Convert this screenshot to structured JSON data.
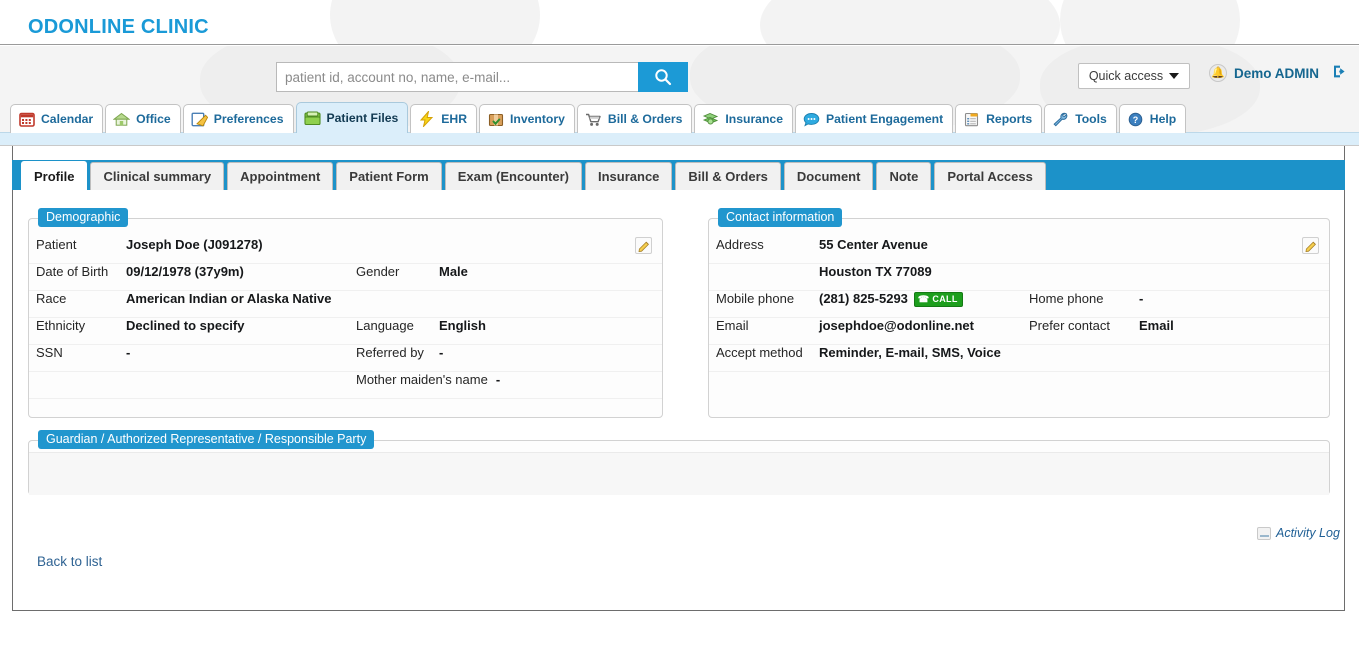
{
  "header": {
    "brand": "ODONLINE CLINIC",
    "search": {
      "placeholder": "patient id, account no, name, e-mail...",
      "value": "",
      "button_icon": "search-icon"
    },
    "quick_access_label": "Quick access",
    "user_name": "Demo ADMIN",
    "bell_icon": "bell-icon",
    "logout_icon": "logout-icon"
  },
  "main_nav": [
    {
      "label": "Calendar",
      "icon": "calendar-icon",
      "active": false
    },
    {
      "label": "Office",
      "icon": "home-icon",
      "active": false
    },
    {
      "label": "Preferences",
      "icon": "note-pencil-icon",
      "active": false
    },
    {
      "label": "Patient Files",
      "icon": "folder-icon",
      "active": true
    },
    {
      "label": "EHR",
      "icon": "lightning-icon",
      "active": false
    },
    {
      "label": "Inventory",
      "icon": "box-icon",
      "active": false
    },
    {
      "label": "Bill & Orders",
      "icon": "cart-icon",
      "active": false
    },
    {
      "label": "Insurance",
      "icon": "money-icon",
      "active": false
    },
    {
      "label": "Patient Engagement",
      "icon": "chat-icon",
      "active": false
    },
    {
      "label": "Reports",
      "icon": "clipboard-icon",
      "active": false
    },
    {
      "label": "Tools",
      "icon": "wrench-icon",
      "active": false
    },
    {
      "label": "Help",
      "icon": "help-icon",
      "active": false
    }
  ],
  "sub_tabs": [
    {
      "label": "Profile",
      "active": true
    },
    {
      "label": "Clinical summary",
      "active": false
    },
    {
      "label": "Appointment",
      "active": false
    },
    {
      "label": "Patient Form",
      "active": false
    },
    {
      "label": "Exam (Encounter)",
      "active": false
    },
    {
      "label": "Insurance",
      "active": false
    },
    {
      "label": "Bill & Orders",
      "active": false
    },
    {
      "label": "Document",
      "active": false
    },
    {
      "label": "Note",
      "active": false
    },
    {
      "label": "Portal Access",
      "active": false
    }
  ],
  "demographic": {
    "legend": "Demographic",
    "edit_icon": "edit-pencil-icon",
    "patient_label": "Patient",
    "patient_value": "Joseph Doe (J091278)",
    "dob_label": "Date of Birth",
    "dob_value": "09/12/1978 (37y9m)",
    "gender_label": "Gender",
    "gender_value": "Male",
    "race_label": "Race",
    "race_value": "American Indian or Alaska Native",
    "ethnicity_label": "Ethnicity",
    "ethnicity_value": "Declined to specify",
    "language_label": "Language",
    "language_value": "English",
    "ssn_label": "SSN",
    "ssn_value": "-",
    "referred_by_label": "Referred by",
    "referred_by_value": "-",
    "mother_maiden_label": "Mother maiden's name",
    "mother_maiden_value": "-"
  },
  "contact": {
    "legend": "Contact information",
    "edit_icon": "edit-pencil-icon",
    "address_label": "Address",
    "address_line1": "55 Center Avenue",
    "address_line2": "Houston TX 77089",
    "mobile_label": "Mobile phone",
    "mobile_value": "(281) 825-5293",
    "call_button_label": "CALL",
    "home_phone_label": "Home phone",
    "home_phone_value": "-",
    "email_label": "Email",
    "email_value": "josephdoe@odonline.net",
    "prefer_contact_label": "Prefer contact",
    "prefer_contact_value": "Email",
    "accept_method_label": "Accept method",
    "accept_method_value": "Reminder, E-mail, SMS, Voice"
  },
  "guardian": {
    "legend": "Guardian / Authorized Representative / Responsible Party"
  },
  "footer": {
    "activity_log_label": "Activity Log",
    "activity_log_icon": "activity-log-icon",
    "back_to_list_label": "Back to list"
  },
  "colors": {
    "brand_blue": "#1a9ad7",
    "tabbar_blue": "#1c92c9",
    "legend_blue": "#2196ce",
    "active_tab_bg": "#dbeefa",
    "call_green": "#1d9e1d",
    "link_blue": "#2f6393"
  }
}
